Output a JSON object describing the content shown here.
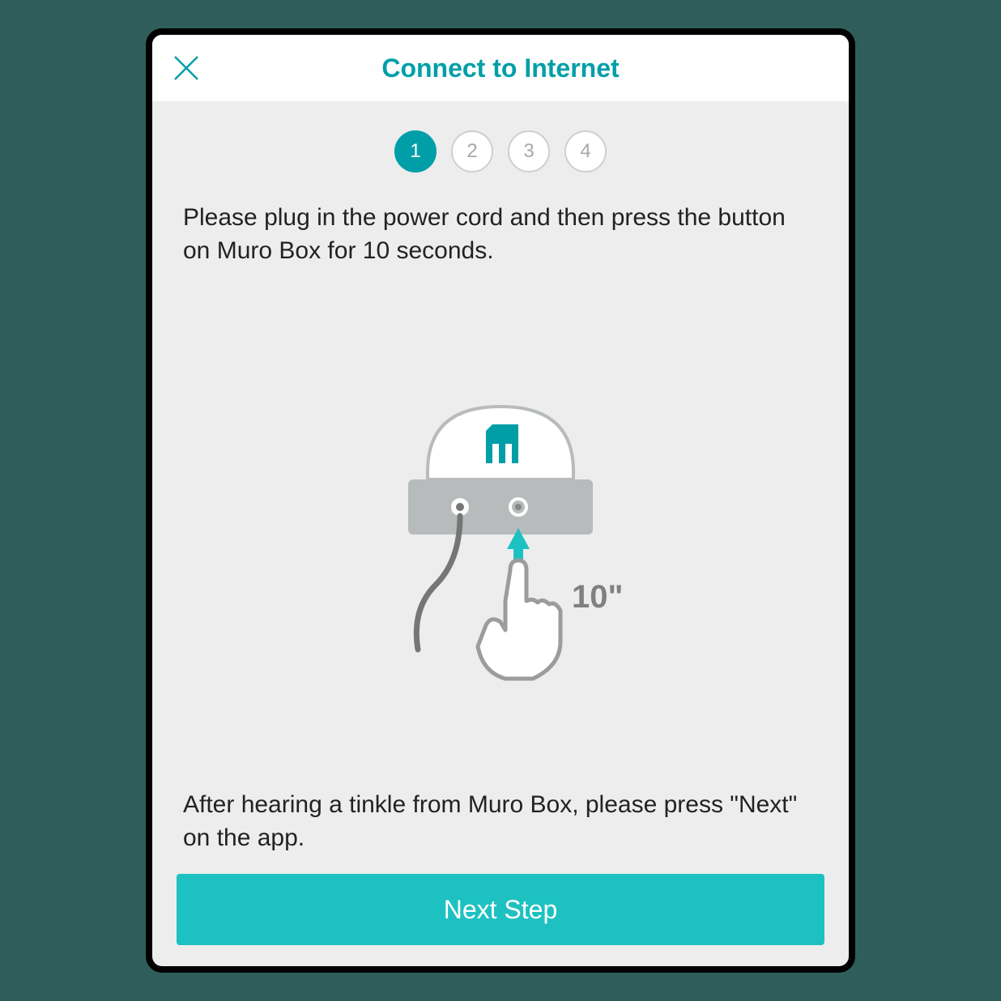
{
  "header": {
    "title": "Connect to Internet"
  },
  "stepper": {
    "steps": [
      "1",
      "2",
      "3",
      "4"
    ],
    "active_index": 0
  },
  "instructions": {
    "top": "Please plug in the power cord and then press the button on Muro Box for 10 seconds.",
    "bottom": "After hearing a tinkle from Muro Box, please press \"Next\" on the app."
  },
  "illustration": {
    "duration_label": "10\""
  },
  "buttons": {
    "next_label": "Next Step"
  },
  "colors": {
    "accent": "#009fa8",
    "button": "#1ec1c1",
    "background": "#ededed"
  }
}
